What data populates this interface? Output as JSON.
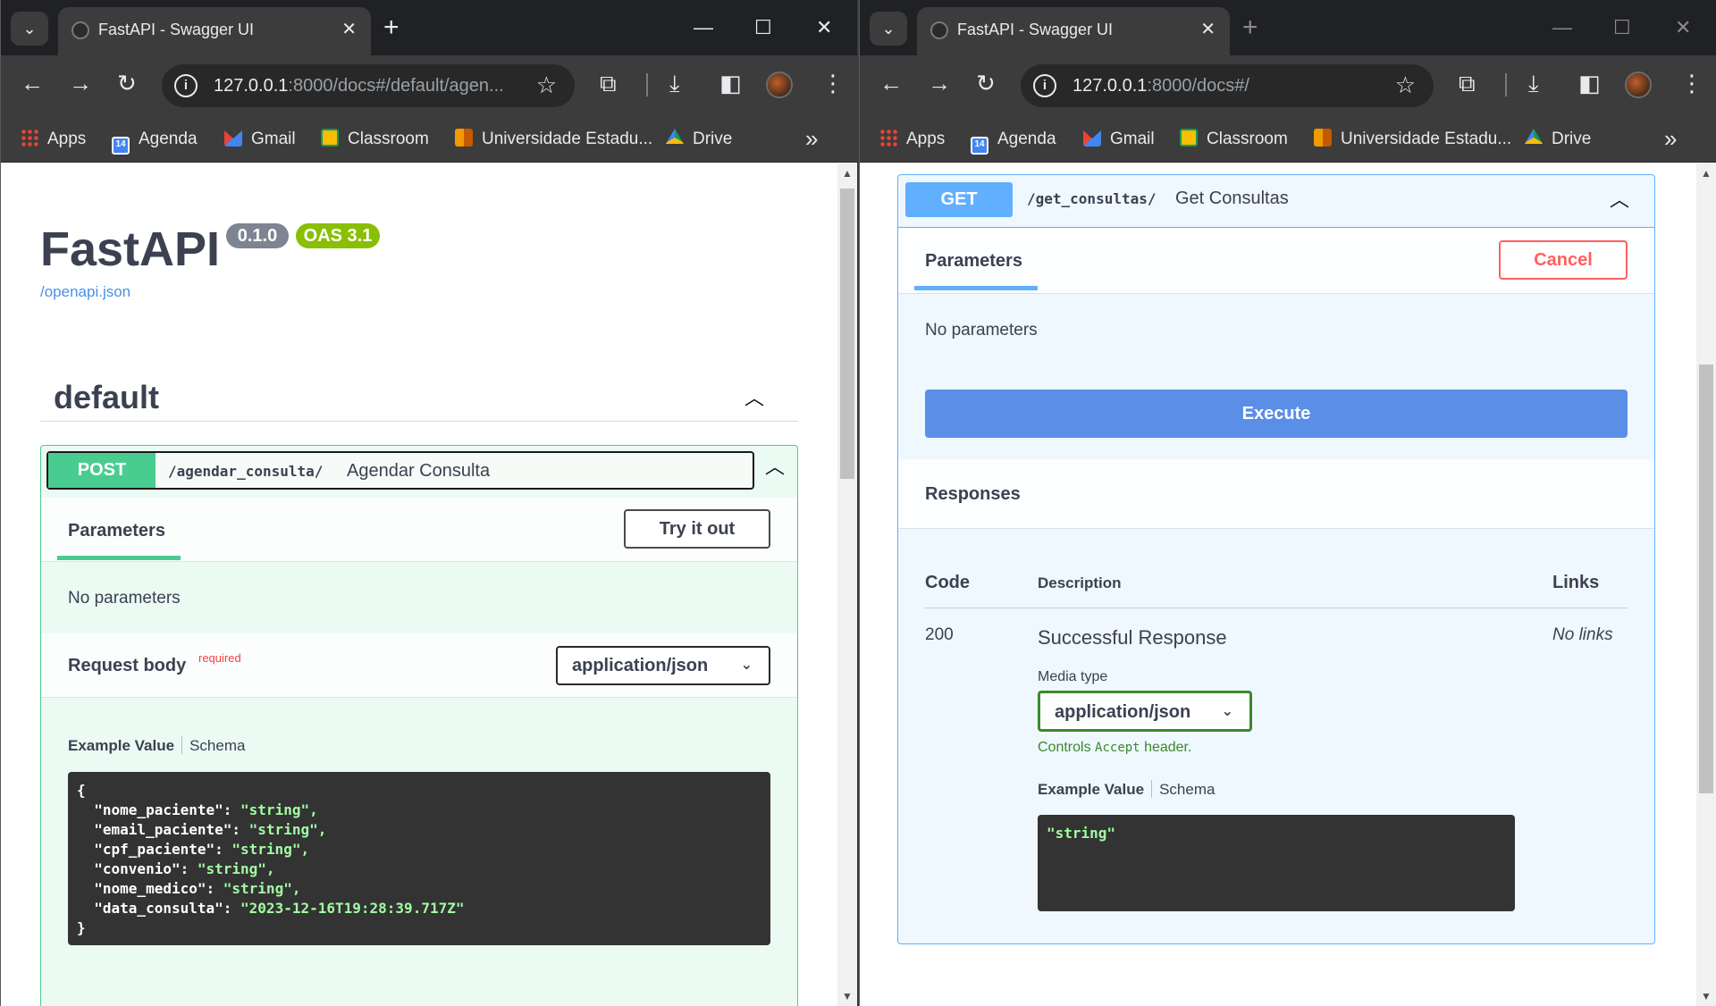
{
  "left": {
    "tab_title": "FastAPI - Swagger UI",
    "url_host": "127.0.0.1",
    "url_rest": ":8000/docs#/default/agen...",
    "bookmarks": [
      "Apps",
      "Agenda",
      "Gmail",
      "Classroom",
      "Universidade Estadu...",
      "Drive"
    ],
    "header": {
      "title": "FastAPI",
      "version": "0.1.0",
      "oas": "OAS 3.1",
      "openapi_link": "/openapi.json"
    },
    "section": "default",
    "operation": {
      "method": "POST",
      "path": "/agendar_consulta/",
      "summary": "Agendar Consulta",
      "parameters_label": "Parameters",
      "try_label": "Try it out",
      "no_params": "No parameters",
      "request_body": "Request body",
      "required": "required",
      "media": "application/json",
      "example_label": "Example Value",
      "schema_label": "Schema",
      "example_lines": [
        {
          "key": "\"nome_paciente\"",
          "val": "\"string\","
        },
        {
          "key": "\"email_paciente\"",
          "val": "\"string\","
        },
        {
          "key": "\"cpf_paciente\"",
          "val": "\"string\","
        },
        {
          "key": "\"convenio\"",
          "val": "\"string\","
        },
        {
          "key": "\"nome_medico\"",
          "val": "\"string\","
        },
        {
          "key": "\"data_consulta\"",
          "val": "\"2023-12-16T19:28:39.717Z\""
        }
      ]
    }
  },
  "right": {
    "tab_title": "FastAPI - Swagger UI",
    "url_host": "127.0.0.1",
    "url_rest": ":8000/docs#/",
    "bookmarks": [
      "Apps",
      "Agenda",
      "Gmail",
      "Classroom",
      "Universidade Estadu...",
      "Drive"
    ],
    "operation": {
      "method": "GET",
      "path": "/get_consultas/",
      "summary": "Get Consultas",
      "parameters_label": "Parameters",
      "cancel_label": "Cancel",
      "no_params": "No parameters",
      "execute_label": "Execute",
      "responses_label": "Responses",
      "col_code": "Code",
      "col_desc": "Description",
      "col_links": "Links",
      "resp_code": "200",
      "resp_desc": "Successful Response",
      "no_links": "No links",
      "media_type_label": "Media type",
      "media": "application/json",
      "controls_pre": "Controls",
      "controls_code": "Accept",
      "controls_post": "header.",
      "example_label": "Example Value",
      "schema_label": "Schema",
      "example": "\"string\""
    }
  },
  "colors": {
    "post": "#49cc90",
    "get": "#61afff",
    "cancel": "#ff6060",
    "execute": "#5b8ee6"
  }
}
